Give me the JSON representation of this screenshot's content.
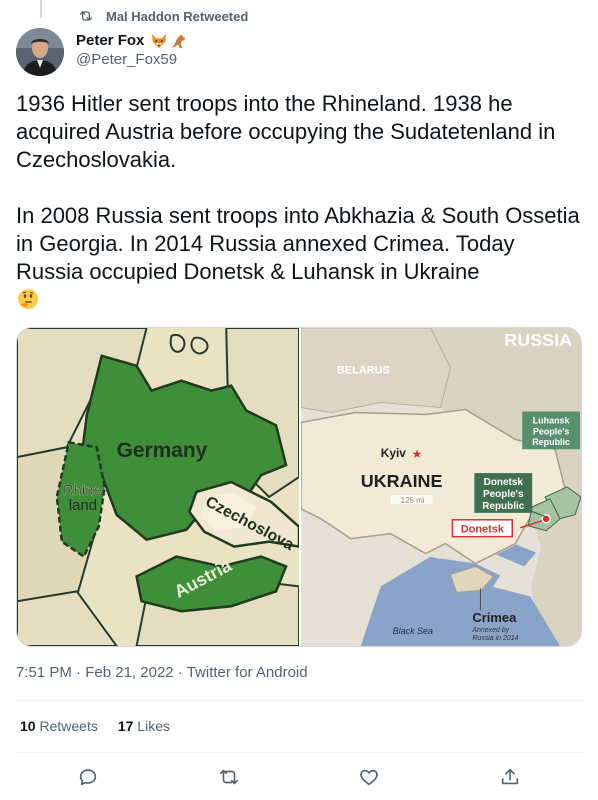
{
  "retweet": {
    "text": "Mal Haddon Retweeted",
    "icon": "retweet-icon"
  },
  "author": {
    "name": "Peter Fox",
    "name_emojis": [
      "fox-emoji",
      "kangaroo-emoji"
    ],
    "handle": "@Peter_Fox59"
  },
  "tweet": {
    "paragraph1": "1936 Hitler sent troops into the Rhineland. 1938 he acquired Austria before occupying the Sudatetenland in Czechoslovakia.",
    "paragraph2": "In 2008 Russia sent troops into Abkhazia & South Ossetia in Georgia. In 2014 Russia annexed Crimea. Today Russia occupied Donetsk & Luhansk in Ukraine",
    "emoji": "thinking-face-emoji"
  },
  "media": {
    "left_map": {
      "labels": {
        "germany": "Germany",
        "rhineland_1": "Rhine",
        "rhineland_2": "land",
        "czechoslovakia": "Czechoslova",
        "austria": "Austria"
      }
    },
    "right_map": {
      "labels": {
        "russia": "RUSSIA",
        "belarus": "BELARUS",
        "kyiv": "Kyiv",
        "ukraine": "UKRAINE",
        "scale": "125 mi",
        "luhansk_1": "Luhansk",
        "luhansk_2": "People's",
        "luhansk_3": "Republic",
        "donetsk_pr_1": "Donetsk",
        "donetsk_pr_2": "People's",
        "donetsk_pr_3": "Republic",
        "donetsk": "Donetsk",
        "black_sea": "Black Sea",
        "crimea": "Crimea",
        "crimea_note_1": "Annexed by",
        "crimea_note_2": "Russia in 2014"
      }
    }
  },
  "meta": {
    "time": "7:51 PM",
    "date": "Feb 21, 2022",
    "source": "Twitter for Android",
    "separator": "·"
  },
  "stats": {
    "retweets_count": "10",
    "retweets_label": "Retweets",
    "likes_count": "17",
    "likes_label": "Likes"
  },
  "actions": [
    "reply-icon",
    "retweet-icon",
    "like-icon",
    "share-icon"
  ],
  "colors": {
    "text_primary": "#0f1419",
    "text_secondary": "#536471",
    "divider": "#eff3f4",
    "germany_green": "#3f8f3a",
    "donetsk_red": "#d9302c",
    "crimea_blue": "#7f9cc4"
  }
}
